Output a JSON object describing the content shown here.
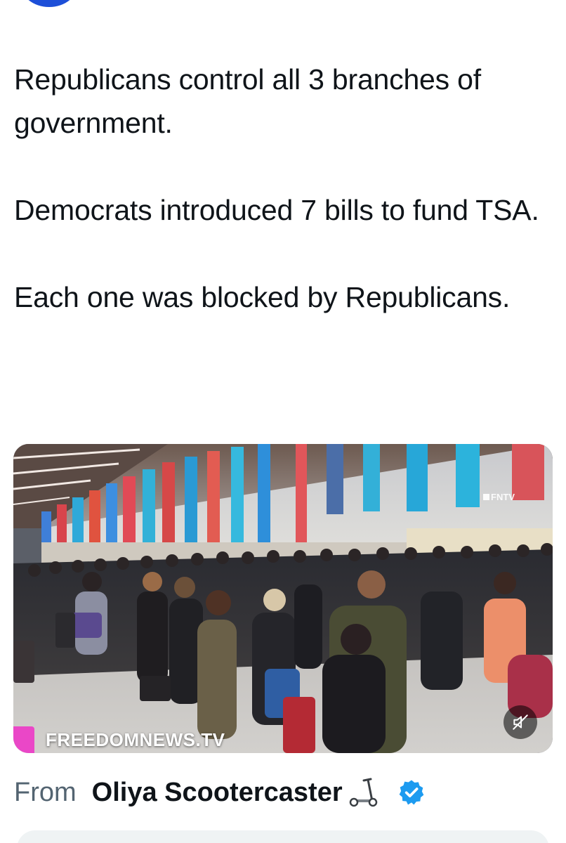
{
  "tweet": {
    "paragraphs": [
      "Republicans control all 3 branches of government.",
      "Democrats introduced 7 bills to fund TSA.",
      "Each one was blocked by Republicans."
    ]
  },
  "media": {
    "type": "video",
    "watermark": "FNTV",
    "brand_label": "FREEDOMNEWS.TV",
    "brand_color": "#ea47c7",
    "mute_icon": "speaker-muted-icon"
  },
  "source": {
    "from_label": "From",
    "name": "Oliya Scootercaster",
    "emoji_icon": "kick-scooter-icon",
    "verified_icon": "verified-badge-icon",
    "verified_color": "#1d9bf0"
  },
  "colors": {
    "text": "#0f1419",
    "secondary": "#536471",
    "avatar": "#1d4fd8"
  }
}
